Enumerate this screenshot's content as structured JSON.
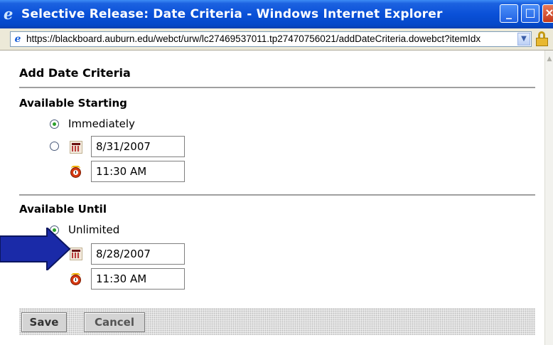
{
  "window": {
    "title": "Selective Release: Date Criteria - Windows Internet Explorer",
    "url": "https://blackboard.auburn.edu/webct/urw/lc27469537011.tp27470756021/addDateCriteria.dowebct?itemIdx"
  },
  "page": {
    "heading": "Add Date Criteria",
    "available_starting": {
      "label": "Available Starting",
      "option_immediately": "Immediately",
      "selected": "immediately",
      "date_value": "8/31/2007",
      "time_value": "11:30 AM"
    },
    "available_until": {
      "label": "Available Until",
      "option_unlimited": "Unlimited",
      "selected": "unlimited",
      "date_value": "8/28/2007",
      "time_value": "11:30 AM"
    },
    "buttons": {
      "save": "Save",
      "cancel": "Cancel"
    }
  },
  "icons": {
    "browser": "ie-icon",
    "secure": "lock-icon",
    "date_picker": "calendar-icon",
    "time_picker": "clock-icon",
    "annotation": "arrow-icon"
  },
  "colors": {
    "titlebar": "#0a50d8",
    "annotation_arrow": "#1a2aa8",
    "radio_checked": "#2aa02a"
  }
}
